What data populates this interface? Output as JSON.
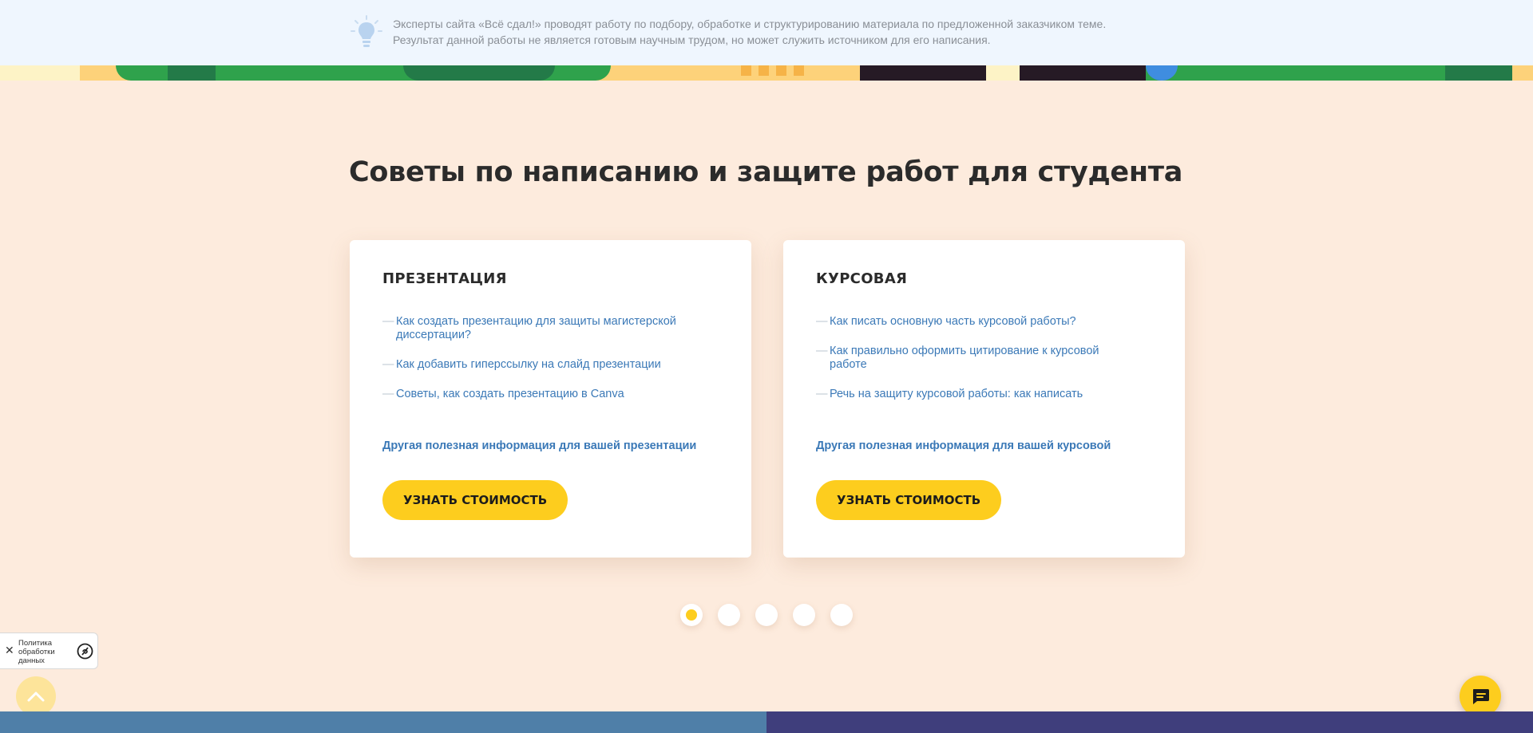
{
  "notice": {
    "line1": "Эксперты сайта «Всё сдал!» проводят работу по подбору, обработке и структурированию материала по предложенной заказчиком теме.",
    "line2": "Результат данной работы не является готовым научным трудом, но может служить источником для его написания.",
    "icon": "lightbulb-icon"
  },
  "section": {
    "heading": "Советы по написанию и защите работ для студента"
  },
  "cards": [
    {
      "title": "ПРЕЗЕНТАЦИЯ",
      "links": [
        "Как создать презентацию для защиты магистерской диссертации?",
        "Как добавить гиперссылку на слайд презентации",
        "Советы, как создать презентацию в Canva"
      ],
      "more": "Другая полезная информация для вашей презентации",
      "button": "УЗНАТЬ СТОИМОСТЬ"
    },
    {
      "title": "КУРСОВАЯ",
      "links": [
        "Как писать основную часть курсовой работы?",
        "Как правильно оформить цитирование к курсовой работе",
        "Речь на защиту курсовой работы: как написать"
      ],
      "more": "Другая полезная информация для вашей курсовой",
      "button": "УЗНАТЬ СТОИМОСТЬ"
    }
  ],
  "pagination": {
    "count": 5,
    "active": 1
  },
  "policy": {
    "text": "Политика обработки данных",
    "close": "✕"
  },
  "colors": {
    "accent": "#fdcd1e",
    "link": "#3b79b7",
    "background": "#fdebdd",
    "notice_bg": "#eff6fe"
  },
  "icons": {
    "scroll_up": "chevron-up-icon",
    "chat": "chat-bubble-icon",
    "policy": "privacy-icon",
    "close": "close-icon"
  }
}
